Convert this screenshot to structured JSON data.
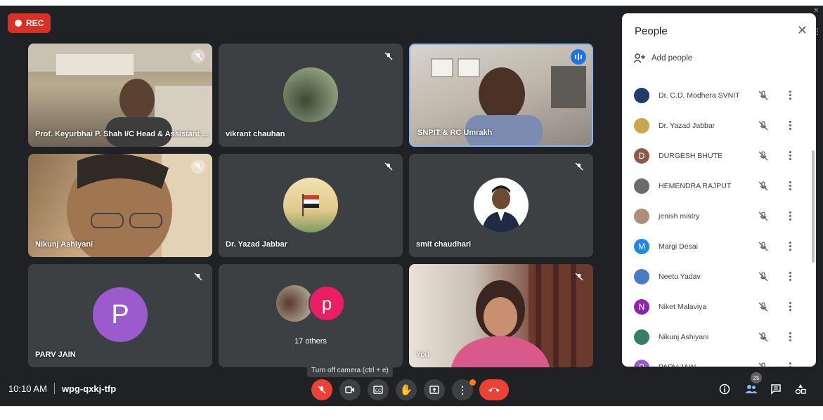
{
  "recording": {
    "label": "REC"
  },
  "tiles": [
    {
      "name": "Prof. Keyurbhai P. Shah I/C Head & Assistant ...",
      "muted": true
    },
    {
      "name": "vikrant chauhan",
      "muted": true
    },
    {
      "name": "SNPIT & RC Umrakh",
      "speaking": true
    },
    {
      "name": "Nikunj Ashiyani",
      "muted": true
    },
    {
      "name": "Dr. Yazad Jabbar",
      "muted": true
    },
    {
      "name": "smit chaudhari",
      "muted": true
    },
    {
      "name": "PARV JAIN",
      "avatar_letter": "P",
      "muted": true
    },
    {
      "name": "17 others",
      "avatar_letter": "p"
    },
    {
      "name": "You",
      "muted": true
    }
  ],
  "colors": {
    "meet_bg": "#202124",
    "tile_bg": "#3c4043",
    "rec_red": "#d93025",
    "parv_avatar": "#9c5bcc",
    "others_avatar": "#e91e63",
    "accent_blue": "#1a73e8"
  },
  "people_panel": {
    "title": "People",
    "add_label": "Add people",
    "people": [
      {
        "name": "Dr. C.D. Modhera SVNIT",
        "avatar": "photo",
        "color": "#1f3a6b"
      },
      {
        "name": "Dr. Yazad Jabbar",
        "avatar": "photo",
        "color": "#c9a64b"
      },
      {
        "name": "DURGESH BHUTE",
        "avatar": "D",
        "color": "#8d5a4a"
      },
      {
        "name": "HEMENDRA RAJPUT",
        "avatar": "photo",
        "color": "#6b6b6b"
      },
      {
        "name": "jenish mistry",
        "avatar": "photo",
        "color": "#b08c7a"
      },
      {
        "name": "Margi Desai",
        "avatar": "M",
        "color": "#1e88e5"
      },
      {
        "name": "Neetu Yadav",
        "avatar": "photo",
        "color": "#4a7bc0"
      },
      {
        "name": "Niket Malaviya",
        "avatar": "N",
        "color": "#8e24aa"
      },
      {
        "name": "Nikunj Ashiyani",
        "avatar": "photo",
        "color": "#3a7a6a"
      },
      {
        "name": "PARV JAIN",
        "avatar": "P",
        "color": "#9c5bcc"
      }
    ]
  },
  "bottom_bar": {
    "time": "10:10 AM",
    "meeting_code": "wpg-qxkj-tfp",
    "tooltip": "Turn off camera (ctrl + e)",
    "participants_count": "25",
    "icons": [
      "mic-off-icon",
      "camera-icon",
      "captions-icon",
      "raise-hand-icon",
      "present-icon",
      "more-options-icon",
      "hang-up-icon",
      "info-icon",
      "people-icon",
      "chat-icon",
      "activities-icon"
    ]
  }
}
